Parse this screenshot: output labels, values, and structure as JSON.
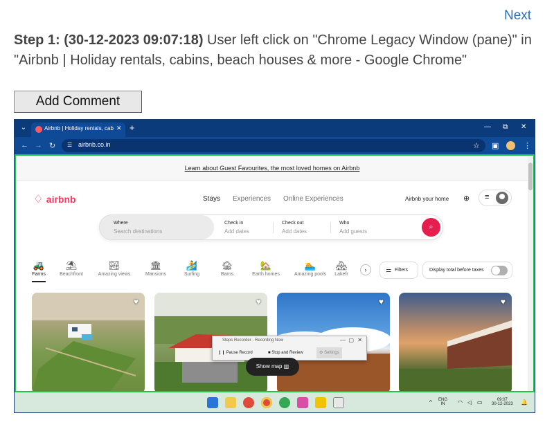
{
  "header": {
    "next_label": "Next",
    "step_prefix": "Step 1: (30-12-2023 09:07:18)",
    "step_description": "User left click on \"Chrome Legacy Window (pane)\" in \"Airbnb | Holiday rentals, cabins, beach houses & more - Google Chrome\"",
    "add_comment_label": "Add Comment"
  },
  "browser": {
    "tab_title": "Airbnb | Holiday rentals, cabins",
    "tab_close": "✕",
    "new_tab": "+",
    "url": "airbnb.co.in",
    "window_controls": [
      "—",
      "⧉",
      "✕"
    ],
    "accent_color": "#0b3b7a"
  },
  "page": {
    "banner_link": "Learn about Guest Favourites, the most loved homes on Airbnb",
    "logo_text": "airbnb",
    "brand_color": "#ff385c",
    "nav": [
      "Stays",
      "Experiences",
      "Online Experiences"
    ],
    "host_link": "Airbnb your home",
    "search": {
      "where_label": "Where",
      "where_placeholder": "Search destinations",
      "checkin_label": "Check in",
      "checkin_placeholder": "Add dates",
      "checkout_label": "Check out",
      "checkout_placeholder": "Add dates",
      "who_label": "Who",
      "who_placeholder": "Add guests"
    },
    "categories": [
      {
        "label": "Farms",
        "icon": "🚜"
      },
      {
        "label": "Beachfront",
        "icon": "⛱"
      },
      {
        "label": "Amazing views",
        "icon": "🏞"
      },
      {
        "label": "Mansions",
        "icon": "🏛"
      },
      {
        "label": "Surfing",
        "icon": "🏄"
      },
      {
        "label": "Barns",
        "icon": "🏚"
      },
      {
        "label": "Earth homes",
        "icon": "🏡"
      },
      {
        "label": "Amazing pools",
        "icon": "🏊"
      },
      {
        "label": "Lakefr",
        "icon": "🏘"
      }
    ],
    "filters_label": "Filters",
    "taxes_label": "Display total before taxes",
    "show_map_label": "Show map"
  },
  "recorder": {
    "title": "Steps Recorder - Recording Now",
    "pause_label": "Pause Record",
    "stop_label": "Stop and Review",
    "settings_label": "Settings"
  },
  "taskbar": {
    "lang_top": "ENG",
    "lang_bottom": "IN",
    "time": "09:07",
    "date": "30-12-2023"
  }
}
